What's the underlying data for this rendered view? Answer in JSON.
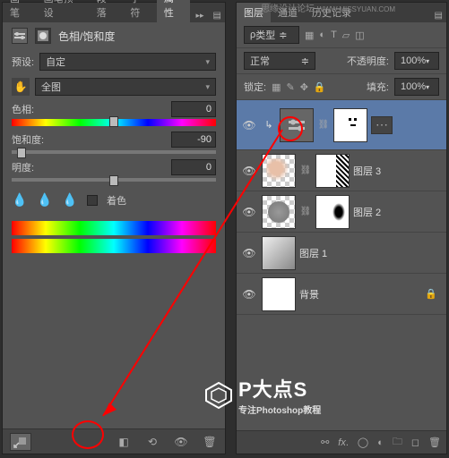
{
  "leftPanel": {
    "tabs": [
      "画笔",
      "画笔预设",
      "段落",
      "字符",
      "属性"
    ],
    "activeTab": 4,
    "title": "色相/饱和度",
    "presetLabel": "预设:",
    "presetValue": "自定",
    "rangeValue": "全图",
    "sliders": {
      "hue": {
        "label": "色相:",
        "value": "0"
      },
      "sat": {
        "label": "饱和度:",
        "value": "-90"
      },
      "light": {
        "label": "明度:",
        "value": "0"
      }
    },
    "colorize": "着色"
  },
  "rightPanel": {
    "tabs": [
      "图层",
      "通道",
      "历史记录"
    ],
    "activeTab": 0,
    "kindLabel": "类型",
    "blendMode": "正常",
    "opacityLabel": "不透明度:",
    "opacityValue": "100%",
    "lockLabel": "锁定:",
    "fillLabel": "填充:",
    "fillValue": "100%",
    "layers": [
      {
        "name": "",
        "type": "adjustment"
      },
      {
        "name": "图层 3",
        "type": "pixel"
      },
      {
        "name": "图层 2",
        "type": "pixel"
      },
      {
        "name": "图层 1",
        "type": "pixel"
      },
      {
        "name": "背景",
        "type": "bg"
      }
    ]
  },
  "watermark": {
    "title": "P大点S",
    "sub": "专注Photoshop教程",
    "header": "思缘设计论坛",
    "url": "WWW.MISSYUAN.COM"
  }
}
